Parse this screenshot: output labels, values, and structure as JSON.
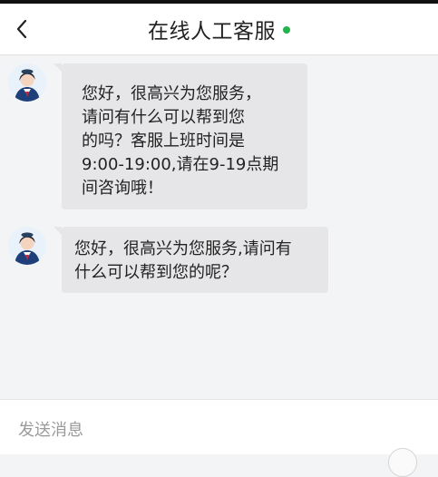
{
  "header": {
    "title": "在线人工客服",
    "status_color": "#22b34c",
    "back_icon": "chevron-left-icon"
  },
  "messages": [
    {
      "sender": "agent",
      "avatar": "agent-avatar",
      "text": "您好，很高兴为您服务，\n请问有什么可以帮到您\n的吗？客服上班时间是\n9:00-19:00,请在9-19点期\n间咨询哦！"
    },
    {
      "sender": "agent",
      "avatar": "agent-avatar",
      "text": "您好，很高兴为您服务,请问有\n什么可以帮到您的呢？"
    }
  ],
  "composer": {
    "placeholder": "发送消息",
    "value": ""
  }
}
